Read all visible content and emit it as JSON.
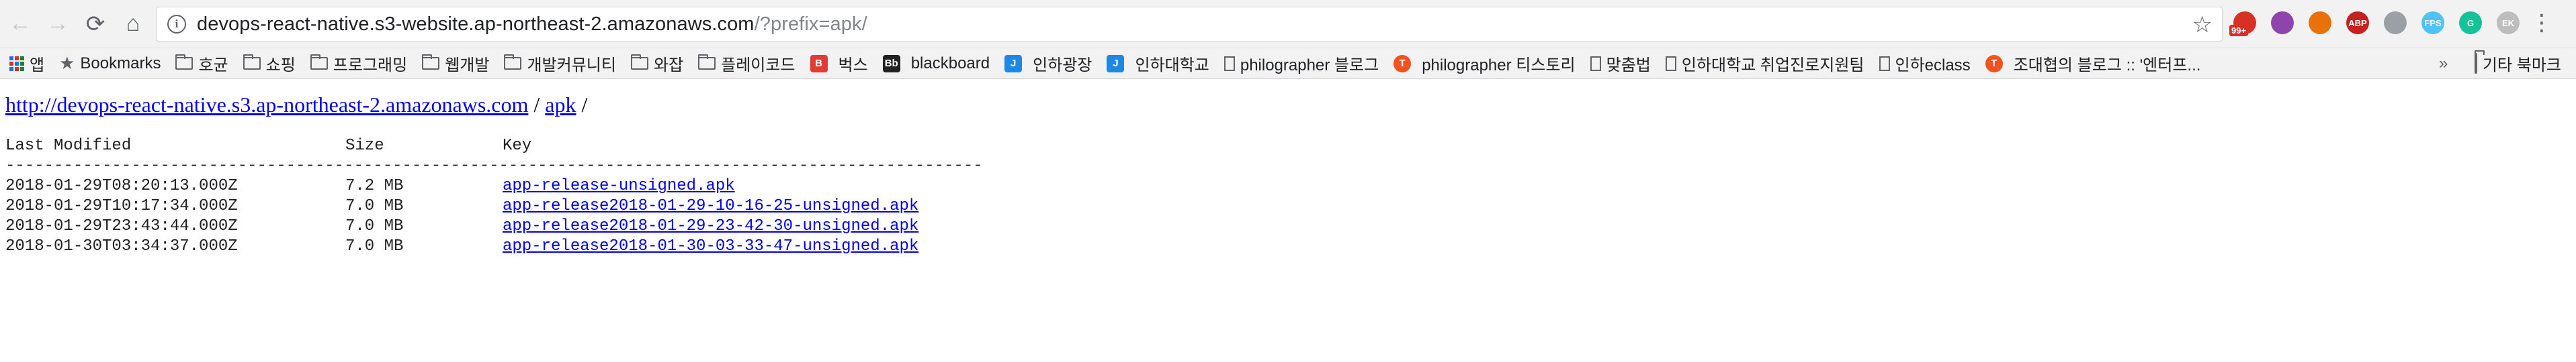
{
  "browser": {
    "url_host": "devops-react-native.s3-website.ap-northeast-2.amazonaws.com",
    "url_rest": "/?prefix=apk/",
    "extensions": [
      {
        "name": "ext-mail",
        "label": "",
        "badge": "99+",
        "color": "#d93025"
      },
      {
        "name": "ext-purple",
        "label": "",
        "color": "#8e44ad"
      },
      {
        "name": "ext-orange",
        "label": "",
        "color": "#e8710a"
      },
      {
        "name": "ext-abp",
        "label": "ABP",
        "color": "#c5221f"
      },
      {
        "name": "ext-grid",
        "label": "",
        "color": "#9aa0a6"
      },
      {
        "name": "ext-fps",
        "label": "FPS",
        "color": "#4fc3f7"
      },
      {
        "name": "ext-grammarly",
        "label": "G",
        "color": "#15c39a"
      },
      {
        "name": "ext-ek",
        "label": "EK",
        "color": "#bdbdbd"
      }
    ]
  },
  "bookmarks": {
    "apps_label": "앱",
    "items": [
      {
        "label": "Bookmarks",
        "icon": "star-icon"
      },
      {
        "label": "호균",
        "icon": "folder-icon"
      },
      {
        "label": "쇼핑",
        "icon": "folder-icon"
      },
      {
        "label": "프로그래밍",
        "icon": "folder-icon"
      },
      {
        "label": "웹개발",
        "icon": "folder-icon"
      },
      {
        "label": "개발커뮤니티",
        "icon": "folder-icon"
      },
      {
        "label": "와잡",
        "icon": "folder-icon"
      },
      {
        "label": "플레이코드",
        "icon": "folder-icon"
      },
      {
        "label": "벅스",
        "icon": "bugs-icon",
        "glyph": "B",
        "color": "#e53935"
      },
      {
        "label": "blackboard",
        "icon": "blackboard-icon",
        "glyph": "Bb",
        "color": "#222222"
      },
      {
        "label": "인하광장",
        "icon": "inha-icon",
        "glyph": "J",
        "color": "#1e88e5"
      },
      {
        "label": "인하대학교",
        "icon": "inha-icon",
        "glyph": "J",
        "color": "#1e88e5"
      },
      {
        "label": "philographer 블로그",
        "icon": "page-icon"
      },
      {
        "label": "philographer 티스토리",
        "icon": "tistory-icon",
        "glyph": "T",
        "color": "#f4511e"
      },
      {
        "label": "맞춤법",
        "icon": "page-icon"
      },
      {
        "label": "인하대학교 취업진로지원팀",
        "icon": "page-icon"
      },
      {
        "label": "인하eclass",
        "icon": "page-icon"
      },
      {
        "label": "조대협의 블로그 :: '엔터프...",
        "icon": "tistory-icon",
        "glyph": "T",
        "color": "#f4511e"
      }
    ],
    "overflow": "»",
    "other_label": "기타 북마크"
  },
  "page": {
    "breadcrumb": {
      "root_link": "http://devops-react-native.s3.ap-northeast-2.amazonaws.com",
      "sep1": " / ",
      "folder_link": "apk",
      "sep2": " /"
    },
    "headers": {
      "modified": "Last Modified",
      "size": "Size",
      "key": "Key"
    },
    "rule": "-----------------------------------------------------------------------------------------------------------------",
    "rows": [
      {
        "modified": "2018-01-29T08:20:13.000Z",
        "size": "7.2 MB",
        "key": "app-release-unsigned.apk"
      },
      {
        "modified": "2018-01-29T10:17:34.000Z",
        "size": "7.0 MB",
        "key": "app-release2018-01-29-10-16-25-unsigned.apk"
      },
      {
        "modified": "2018-01-29T23:43:44.000Z",
        "size": "7.0 MB",
        "key": "app-release2018-01-29-23-42-30-unsigned.apk"
      },
      {
        "modified": "2018-01-30T03:34:37.000Z",
        "size": "7.0 MB",
        "key": "app-release2018-01-30-03-33-47-unsigned.apk"
      }
    ]
  }
}
